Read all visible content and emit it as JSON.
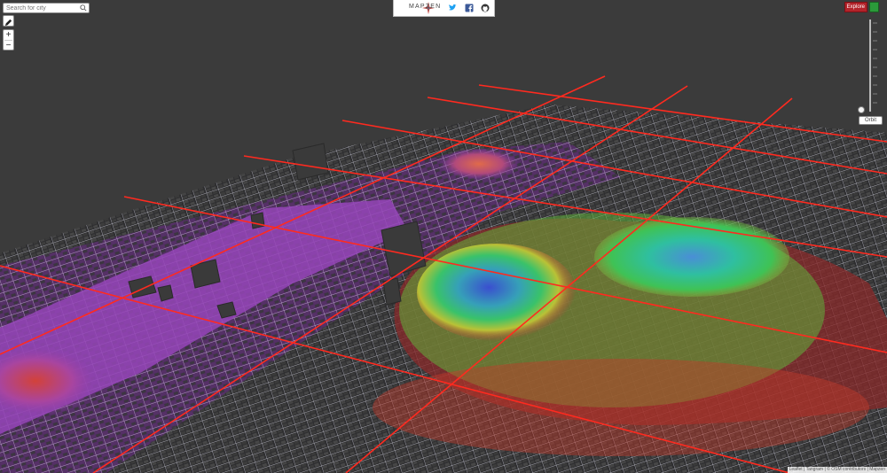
{
  "search": {
    "placeholder": "Search for city"
  },
  "controls": {
    "edit_icon": "pencil-icon",
    "zoom_in": "+",
    "zoom_out": "−"
  },
  "logo": {
    "text": "MAPZEN"
  },
  "share": [
    "twitter-icon",
    "facebook-icon",
    "github-icon"
  ],
  "right": {
    "gui_label": "Explore",
    "orbit_label": "Orbit"
  },
  "attribution": "Leaflet | Tangram | © OSM contributors | Mapzen",
  "colors": {
    "background": "#3b3b3b",
    "grid_lines": "#ff2a1f",
    "buildings": "#333333",
    "roads": "#e8e8f0",
    "elevation_low": "#8a2fa8",
    "elevation_mid": "#2fbf5a",
    "elevation_high": "#c42222"
  }
}
